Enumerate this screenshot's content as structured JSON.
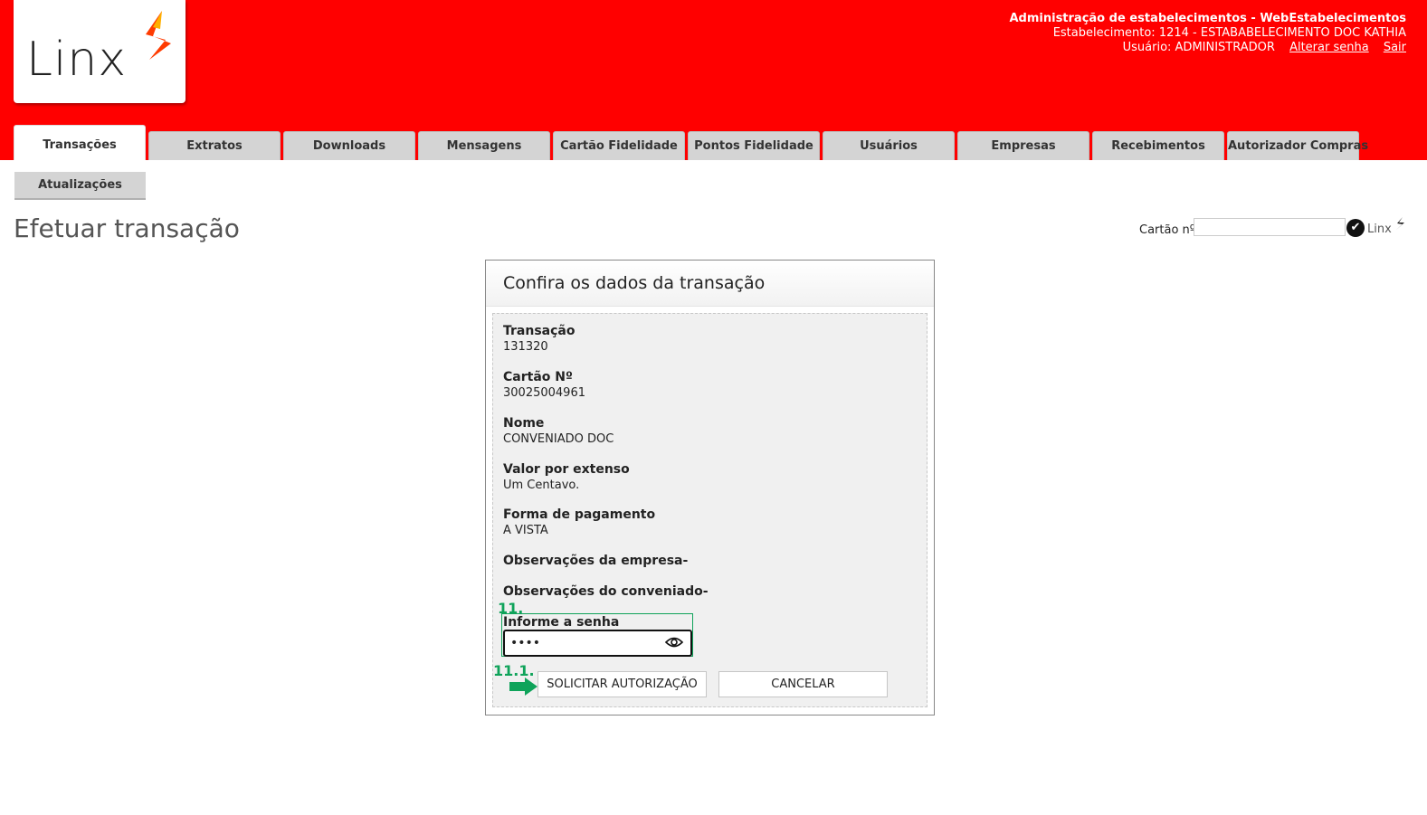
{
  "header": {
    "logo_text": "Linx",
    "system_title": "Administração de estabelecimentos - WebEstabelecimentos",
    "establishment": "Estabelecimento: 1214 - ESTABABELECIMENTO DOC KATHIA",
    "user": "Usuário: ADMINISTRADOR",
    "change_password_link": "Alterar senha",
    "logout_link": "Sair",
    "brand_color": "#ff0000"
  },
  "tabs": [
    {
      "label": "Transações",
      "active": true
    },
    {
      "label": "Extratos"
    },
    {
      "label": "Downloads"
    },
    {
      "label": "Mensagens"
    },
    {
      "label": "Cartão Fidelidade"
    },
    {
      "label": "Pontos Fidelidade"
    },
    {
      "label": "Usuários"
    },
    {
      "label": "Empresas"
    },
    {
      "label": "Recebimentos"
    },
    {
      "label": "Autorizador Compras"
    }
  ],
  "subtabs": [
    {
      "label": "Atualizações"
    }
  ],
  "page_title": "Efetuar transação",
  "card_search": {
    "label": "Cartão nº",
    "value": "",
    "brand": "Linx"
  },
  "dialog": {
    "title": "Confira os dados da transação",
    "fields": [
      {
        "label": "Transação",
        "value": "131320"
      },
      {
        "label": "Cartão Nº",
        "value": "30025004961"
      },
      {
        "label": "Nome",
        "value": "CONVENIADO DOC"
      },
      {
        "label": "Valor por extenso",
        "value": "Um Centavo."
      },
      {
        "label": "Forma de pagamento",
        "value": "A VISTA"
      }
    ],
    "obs_company": "Observações da empresa-",
    "obs_member": "Observações do conveniado-",
    "password_label": "Informe a senha",
    "password_value": "••••",
    "annotation_step": "11.",
    "annotation_substep": "11.1.",
    "annotation_color": "#0fa35a",
    "authorize_button": "SOLICITAR AUTORIZAÇÃO",
    "cancel_button": "CANCELAR"
  }
}
